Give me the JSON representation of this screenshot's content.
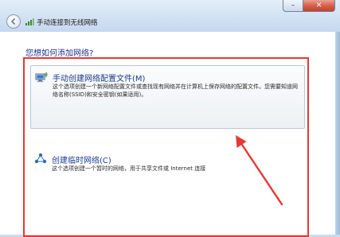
{
  "window": {
    "title": "手动连接到无线网络",
    "controls": {
      "minimize": "–",
      "close": "✕"
    }
  },
  "heading": "您想如何添加网络?",
  "options": [
    {
      "title": "手动创建网络配置文件(M)",
      "description": "这个选项创建一个新网络配置文件或查找现有网络并在计算机上保存网络的配置文件。您需要知道网络名称(SSID)和安全密钥(如果适用)。",
      "icon": "wireless-computer-icon",
      "selected": true
    },
    {
      "title": "创建临时网络(C)",
      "description": "这个选项创建一个暂时的网络，用于共享文件或 Internet 连接",
      "icon": "adhoc-network-icon",
      "selected": false
    }
  ],
  "annotation": {
    "highlight_color": "#e53935"
  },
  "colors": {
    "link_blue": "#1a3b8c",
    "heading_blue": "#1e3287",
    "close_red": "#c3422b"
  }
}
